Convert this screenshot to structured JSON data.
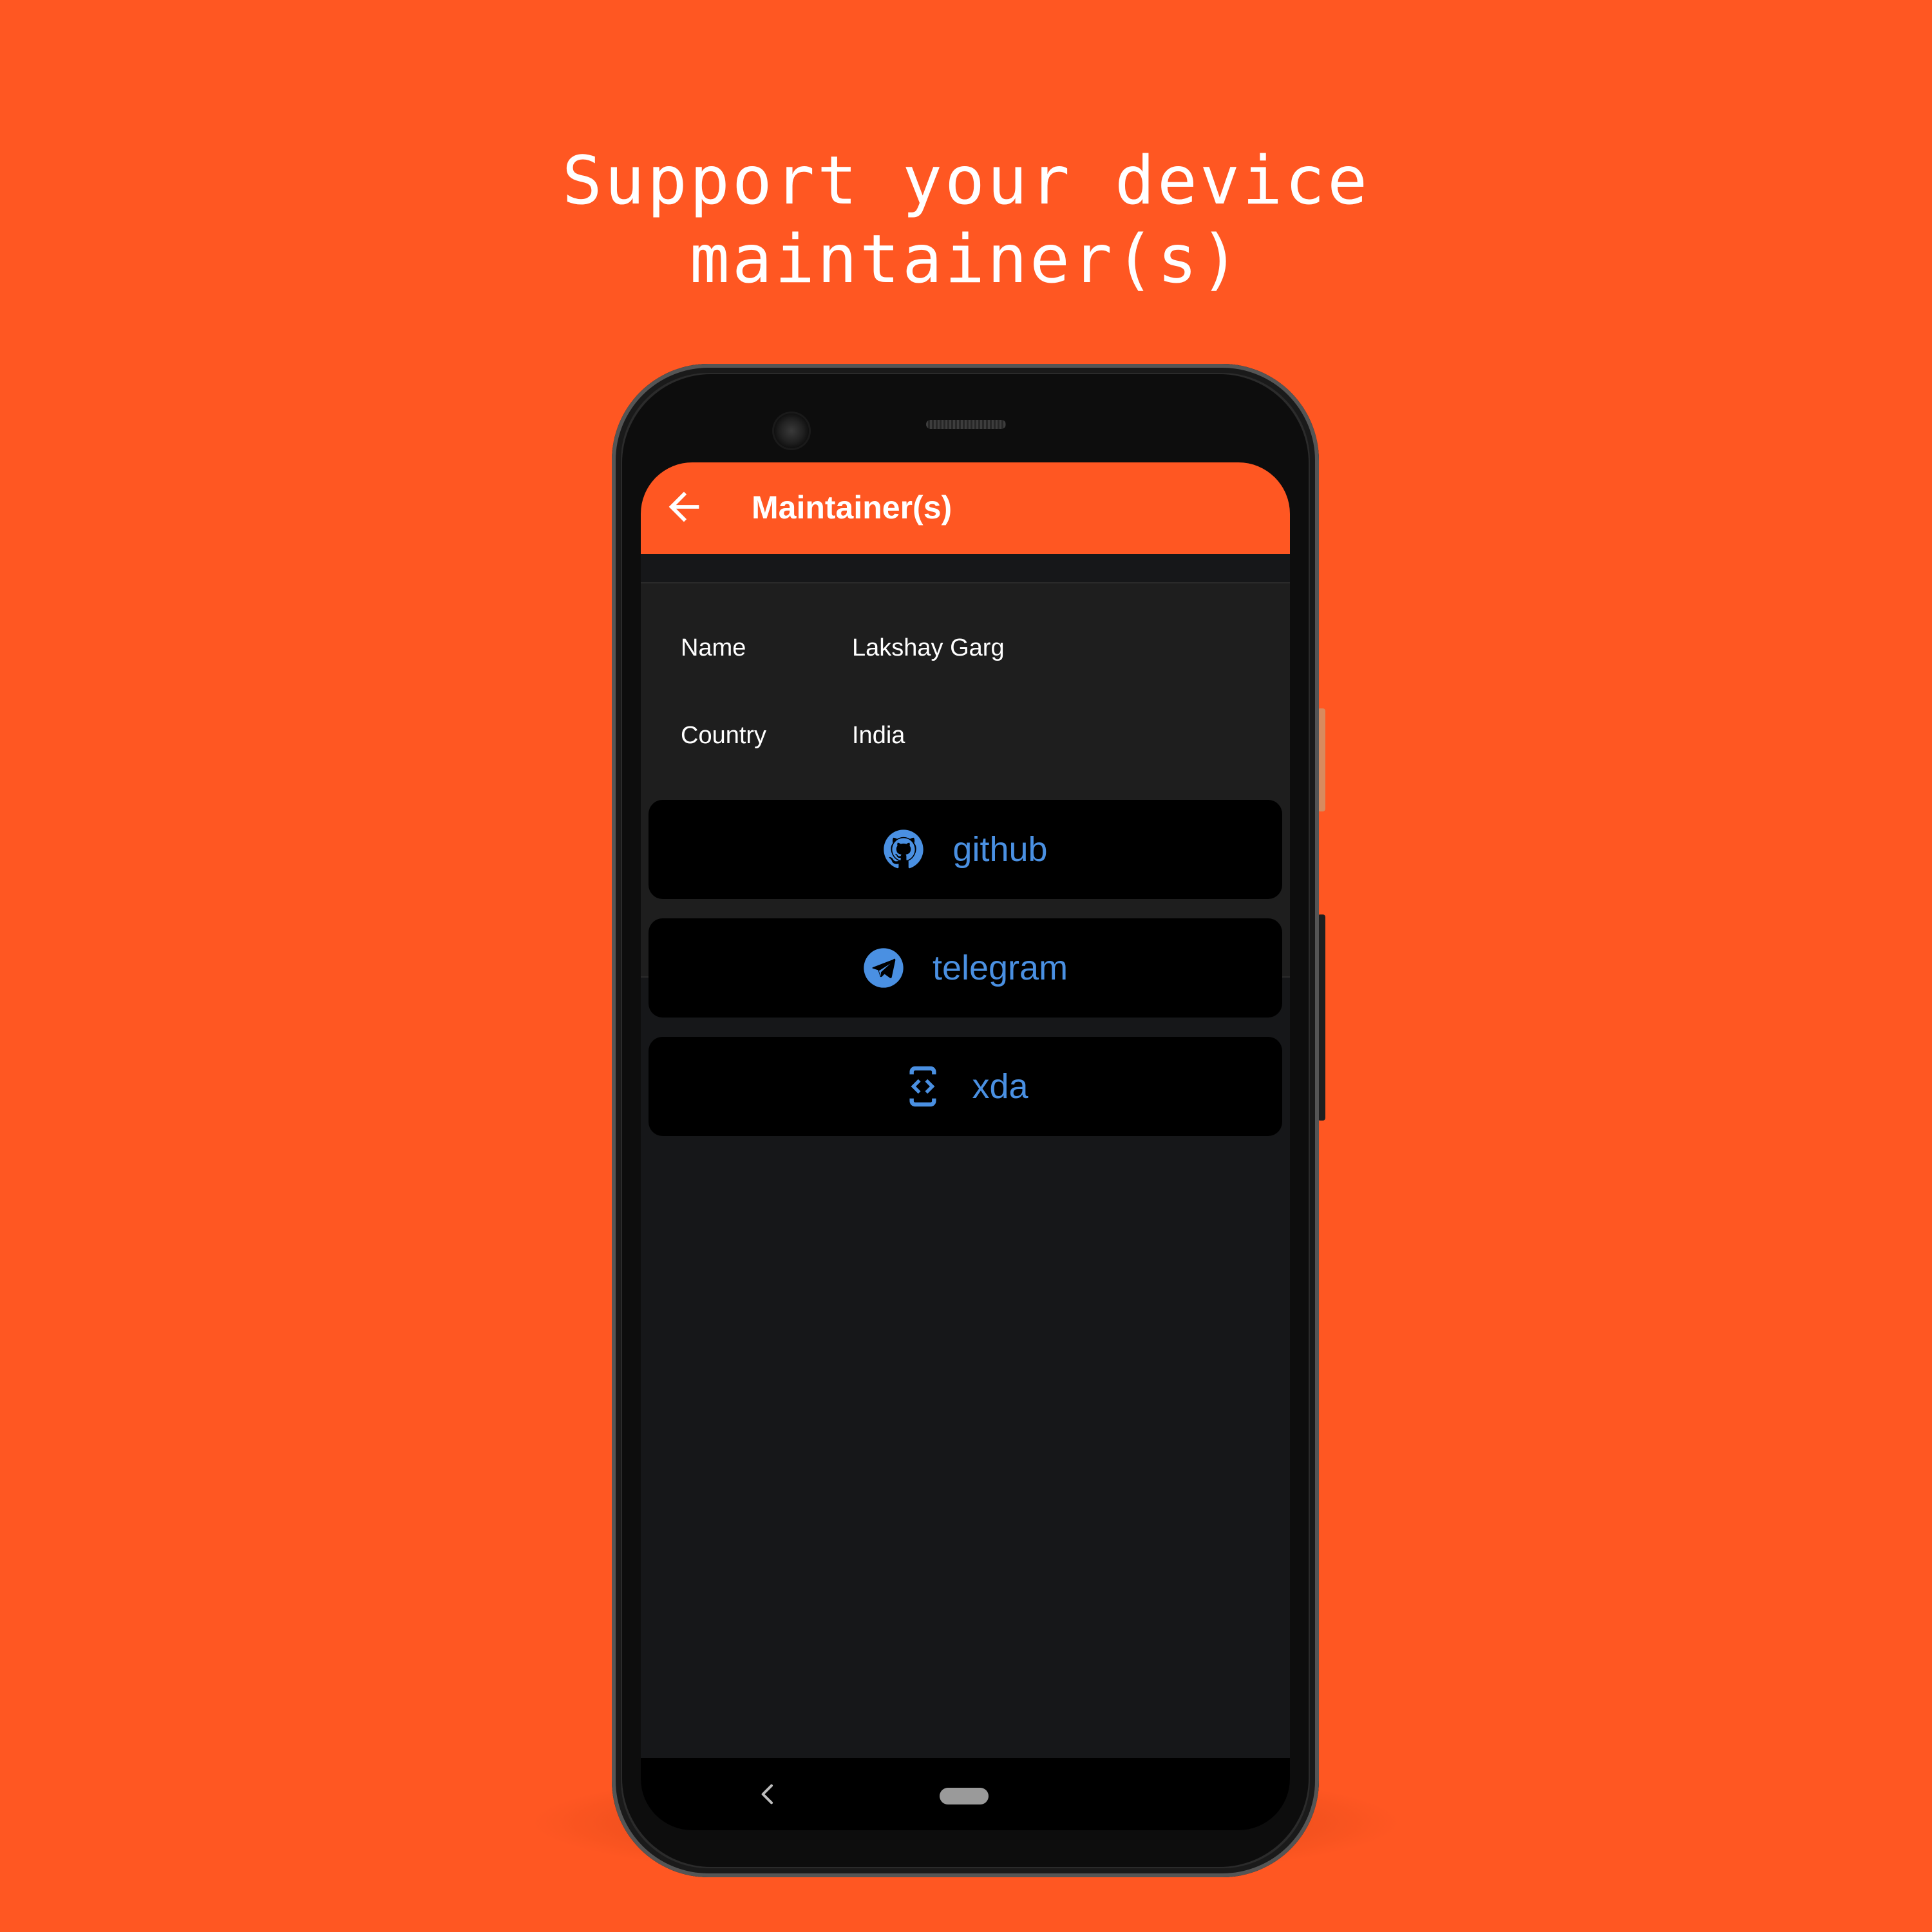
{
  "headline": {
    "line1": "Support your device",
    "line2": "maintainer(s)"
  },
  "colors": {
    "accent": "#FF5722",
    "link": "#4A90E2",
    "screen_bg": "#161719",
    "card_bg": "#1E1E1E",
    "button_bg": "#000000"
  },
  "appbar": {
    "title": "Maintainer(s)",
    "back_icon": "arrow-left-icon"
  },
  "maintainer": {
    "name_label": "Name",
    "name_value": "Lakshay Garg",
    "country_label": "Country",
    "country_value": "India"
  },
  "links": [
    {
      "label": "github",
      "icon": "github-icon"
    },
    {
      "label": "telegram",
      "icon": "telegram-icon"
    },
    {
      "label": "xda",
      "icon": "xda-icon"
    }
  ],
  "navbar": {
    "back_icon": "chevron-left-icon",
    "home_icon": "home-pill-icon"
  }
}
